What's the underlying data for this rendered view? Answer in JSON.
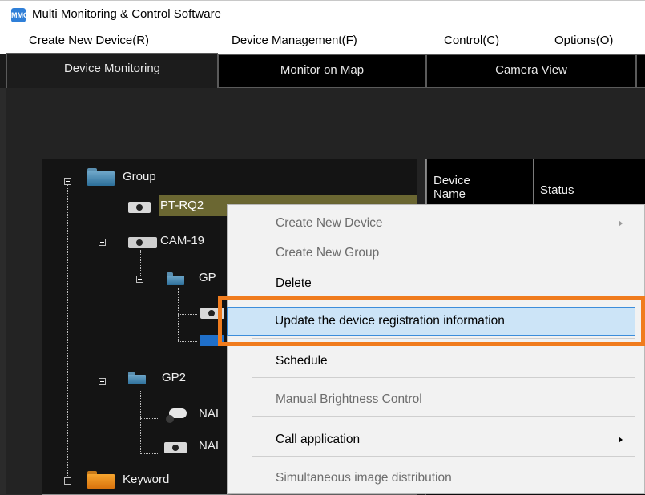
{
  "window": {
    "title": "Multi Monitoring & Control Software",
    "icon": "app-logo-icon",
    "icon_text": "MMC"
  },
  "menu": [
    "Create New Device(R)",
    "Device Management(F)",
    "Control(C)",
    "Options(O)"
  ],
  "tabs": [
    {
      "label": "Device Monitoring",
      "active": true
    },
    {
      "label": "Monitor on Map",
      "active": false
    },
    {
      "label": "Camera View",
      "active": false
    }
  ],
  "tree": {
    "nodes": [
      {
        "label": "Group",
        "icon": "folder-icon"
      },
      {
        "label": "PT-RQ2",
        "icon": "projector-icon",
        "selected": true
      },
      {
        "label": "CAM-19",
        "icon": "camera-icon"
      },
      {
        "label": "GP",
        "icon": "folder-icon"
      },
      {
        "label": "",
        "icon": "projector-icon"
      },
      {
        "label": "",
        "icon": "display-icon"
      },
      {
        "label": "GP2",
        "icon": "folder-icon"
      },
      {
        "label": "NAI",
        "icon": "camera-icon"
      },
      {
        "label": "NAI",
        "icon": "projector-icon"
      },
      {
        "label": "Keyword",
        "icon": "folder-icon"
      }
    ]
  },
  "table": {
    "headers": [
      "Device\nName",
      "Status"
    ]
  },
  "context_menu": {
    "items": [
      {
        "label": "Create New Device",
        "enabled": false,
        "submenu": true
      },
      {
        "label": "Create New Group",
        "enabled": false,
        "submenu": false
      },
      {
        "label": "Delete",
        "enabled": true,
        "submenu": false
      },
      {
        "label": "Update the device registration information",
        "enabled": true,
        "submenu": false,
        "highlighted": true
      },
      {
        "label": "Schedule",
        "enabled": true,
        "submenu": false
      },
      {
        "label": "Manual Brightness Control",
        "enabled": false,
        "submenu": false
      },
      {
        "label": "Call application",
        "enabled": true,
        "submenu": true
      },
      {
        "label": "Simultaneous image distribution",
        "enabled": false,
        "submenu": false
      }
    ]
  },
  "colors": {
    "highlight_border": "#f07c1e",
    "hover_fill": "#cce4f7",
    "tree_selected": "#6b6732"
  }
}
